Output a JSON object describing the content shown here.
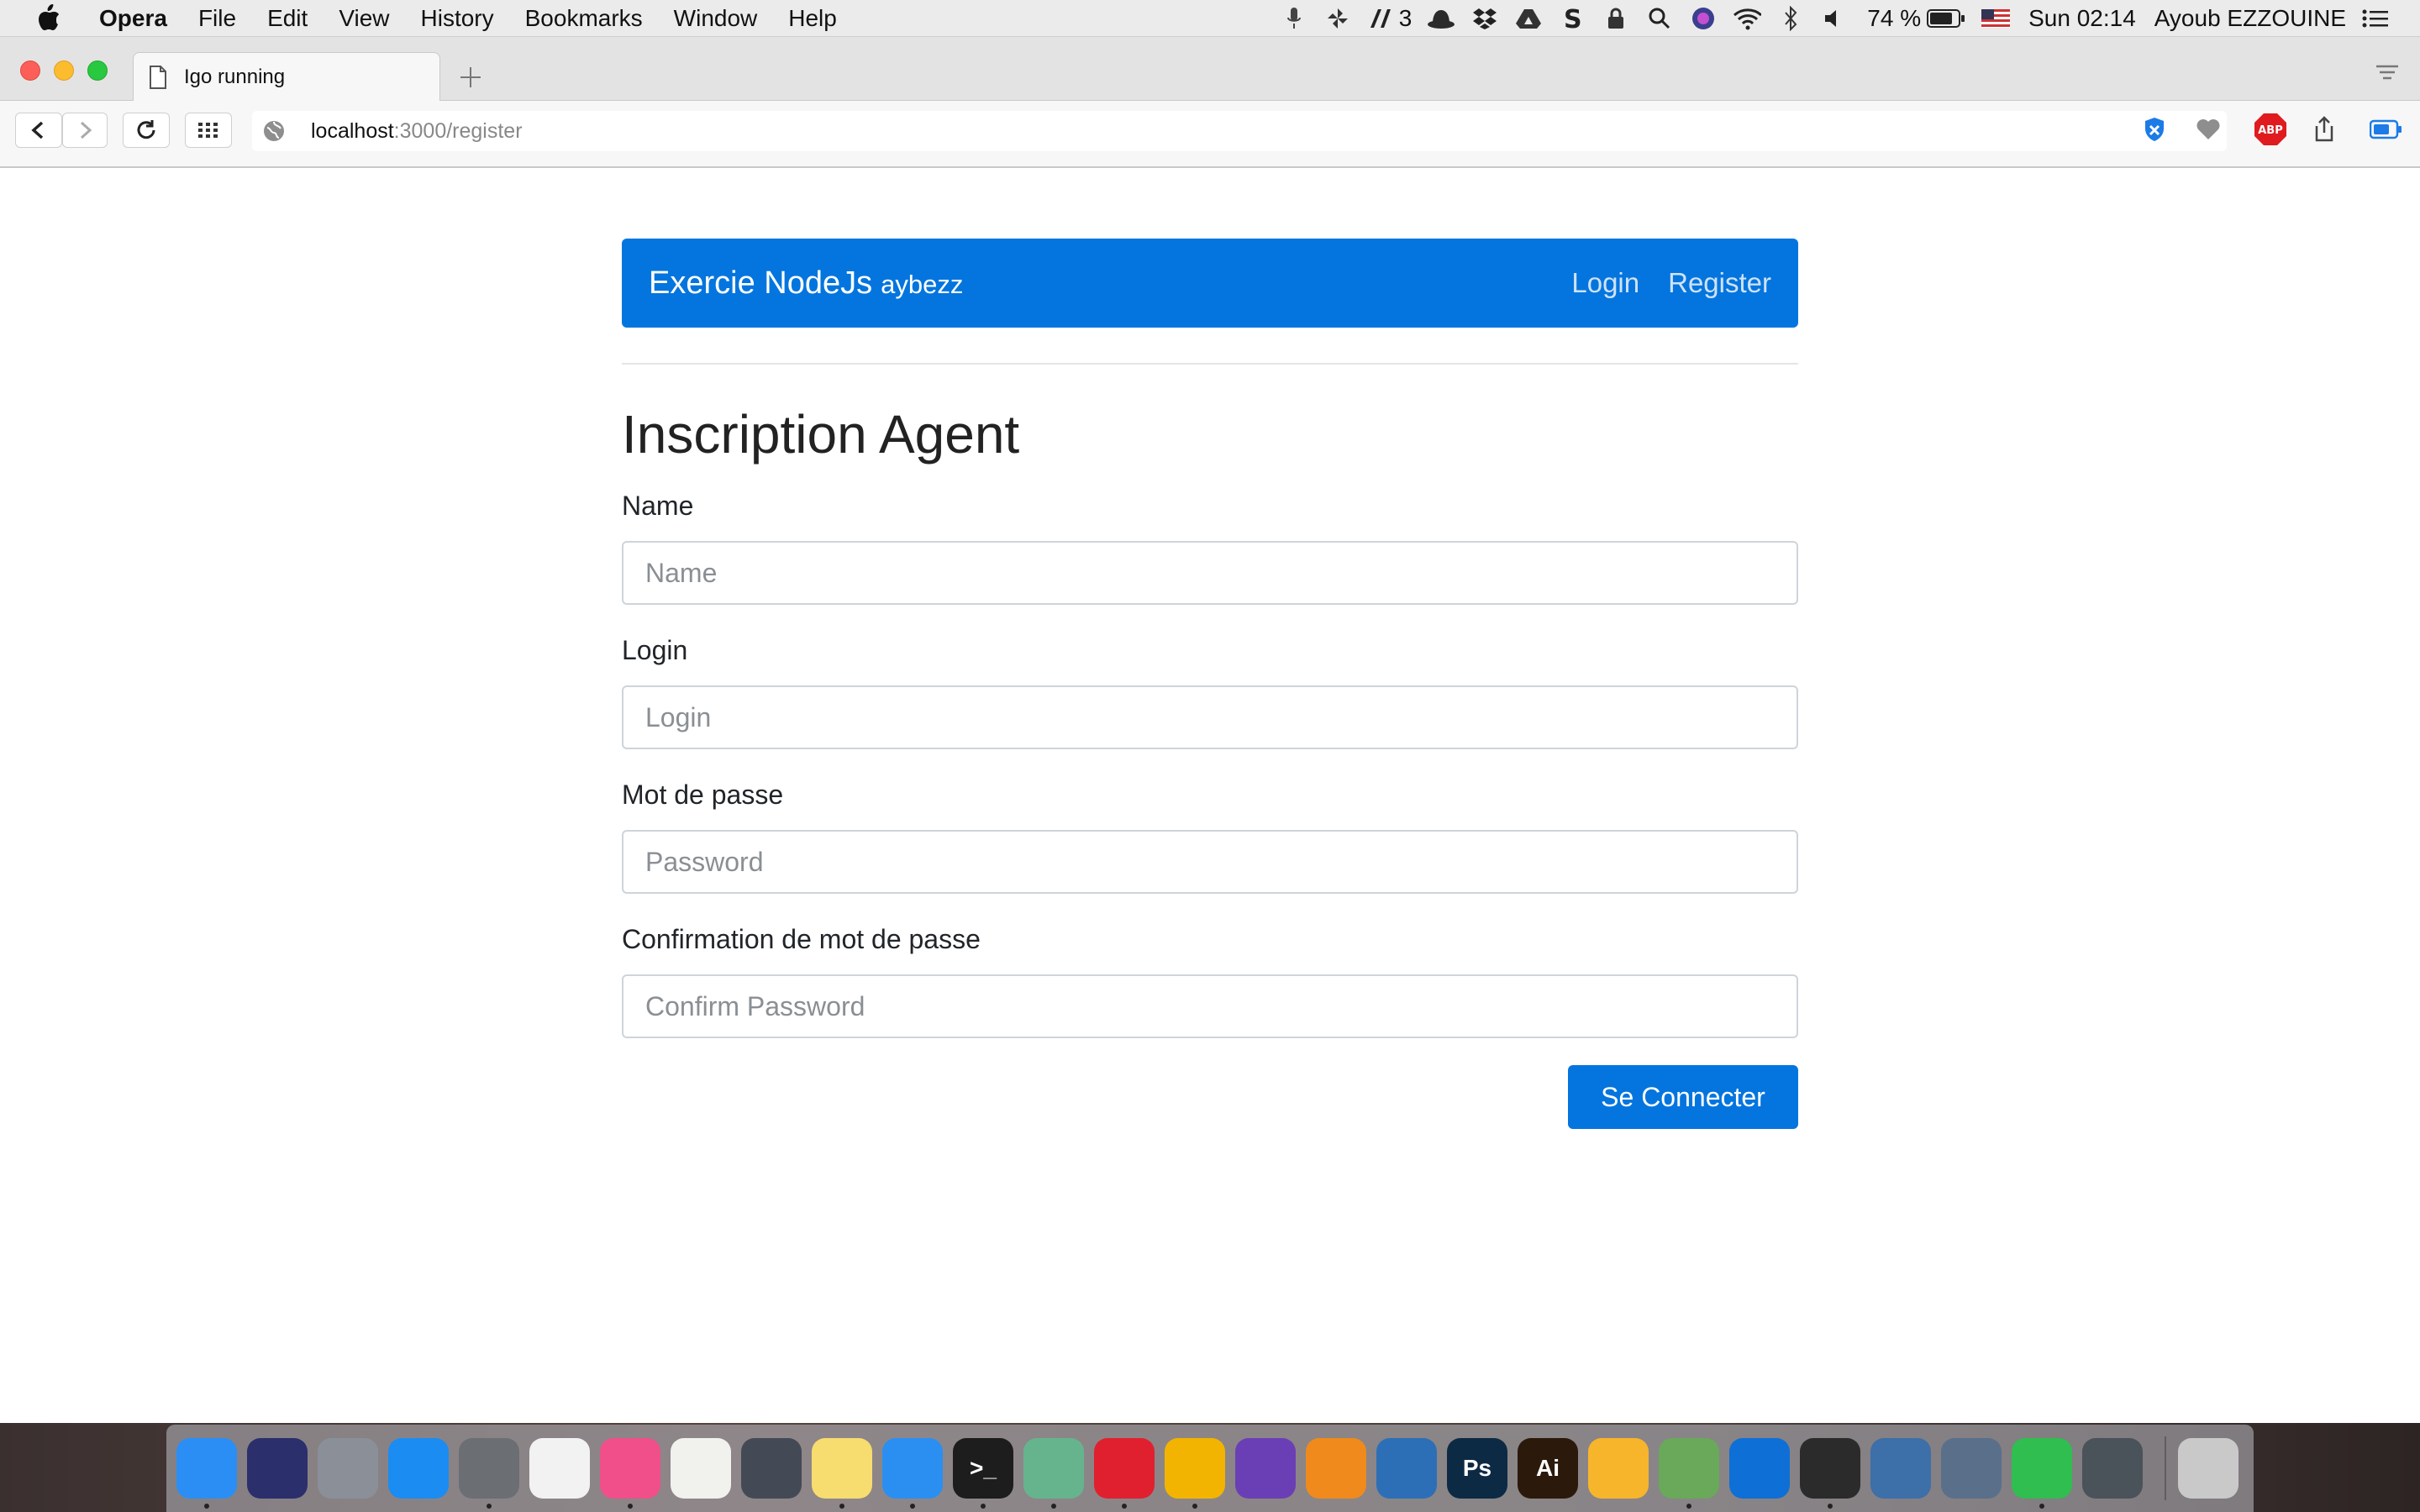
{
  "menubar": {
    "app": "Opera",
    "items": [
      "File",
      "Edit",
      "View",
      "History",
      "Bookmarks",
      "Window",
      "Help"
    ],
    "status": {
      "adobe_count": "3",
      "battery": "74 %",
      "clock": "Sun 02:14",
      "user": "Ayoub EZZOUINE"
    }
  },
  "browser": {
    "tab_title": "Igo running",
    "url_host": "localhost",
    "url_path": ":3000/register",
    "adblock_label": "ABP"
  },
  "navbar": {
    "brand": "Exercie NodeJs",
    "brand_sub": "aybezz",
    "links": [
      "Login",
      "Register"
    ]
  },
  "form": {
    "title": "Inscription Agent",
    "fields": [
      {
        "label": "Name",
        "placeholder": "Name"
      },
      {
        "label": "Login",
        "placeholder": "Login"
      },
      {
        "label": "Mot de passe",
        "placeholder": "Password"
      },
      {
        "label": "Confirmation de mot de passe",
        "placeholder": "Confirm Password"
      }
    ],
    "submit": "Se Connecter"
  },
  "colors": {
    "primary": "#0475de",
    "menubar": "#ecebeb"
  },
  "dock": {
    "apps": [
      {
        "name": "finder-icon",
        "color": "#2a8ef5",
        "label": "",
        "running": true
      },
      {
        "name": "siri-icon",
        "color": "#2b2f6b",
        "label": "",
        "running": false
      },
      {
        "name": "launchpad-icon",
        "color": "#8a8f98",
        "label": "",
        "running": false
      },
      {
        "name": "app-store-icon",
        "color": "#1b8cf2",
        "label": "",
        "running": false
      },
      {
        "name": "system-preferences-icon",
        "color": "#6b6e73",
        "label": "",
        "running": true
      },
      {
        "name": "grid-app-icon",
        "color": "#f2f2f2",
        "label": "",
        "running": false
      },
      {
        "name": "itunes-icon",
        "color": "#f04f8a",
        "label": "",
        "running": true
      },
      {
        "name": "textedit-icon",
        "color": "#f1f1ee",
        "label": "",
        "running": false
      },
      {
        "name": "quicktime-icon",
        "color": "#444a55",
        "label": "",
        "running": false
      },
      {
        "name": "notes-icon",
        "color": "#f7dc6f",
        "label": "",
        "running": true
      },
      {
        "name": "safari-icon",
        "color": "#2b8ff2",
        "label": "",
        "running": true
      },
      {
        "name": "terminal-icon",
        "color": "#1d1d1d",
        "label": ">_",
        "running": true
      },
      {
        "name": "atom-icon",
        "color": "#66b48d",
        "label": "",
        "running": true
      },
      {
        "name": "opera-icon",
        "color": "#e0202f",
        "label": "",
        "running": true
      },
      {
        "name": "chrome-icon",
        "color": "#f2b400",
        "label": "",
        "running": true
      },
      {
        "name": "nightly-icon",
        "color": "#6a3fb5",
        "label": "",
        "running": false
      },
      {
        "name": "mr-app-icon",
        "color": "#f08a1c",
        "label": "",
        "running": false
      },
      {
        "name": "container-app-icon",
        "color": "#2c6fb6",
        "label": "",
        "running": false
      },
      {
        "name": "photoshop-icon",
        "color": "#0d2a45",
        "label": "Ps",
        "running": false
      },
      {
        "name": "illustrator-icon",
        "color": "#2b1a0b",
        "label": "Ai",
        "running": false
      },
      {
        "name": "sketch-icon",
        "color": "#f7b52c",
        "label": "",
        "running": false
      },
      {
        "name": "android-studio-icon",
        "color": "#6aa85a",
        "label": "",
        "running": true
      },
      {
        "name": "teamviewer-icon",
        "color": "#0e6fd6",
        "label": "",
        "running": false
      },
      {
        "name": "acrobat-icon",
        "color": "#2b2b2b",
        "label": "",
        "running": true
      },
      {
        "name": "virtualbox-icon",
        "color": "#3d6fa8",
        "label": "",
        "running": false
      },
      {
        "name": "remote-desktop-icon",
        "color": "#5a6f8a",
        "label": "",
        "running": false
      },
      {
        "name": "whatsapp-icon",
        "color": "#2fbe4f",
        "label": "",
        "running": true
      },
      {
        "name": "elephant-app-icon",
        "color": "#4a525a",
        "label": "",
        "running": false
      }
    ],
    "trash": {
      "name": "trash-icon",
      "color": "#c9c9c9"
    }
  }
}
